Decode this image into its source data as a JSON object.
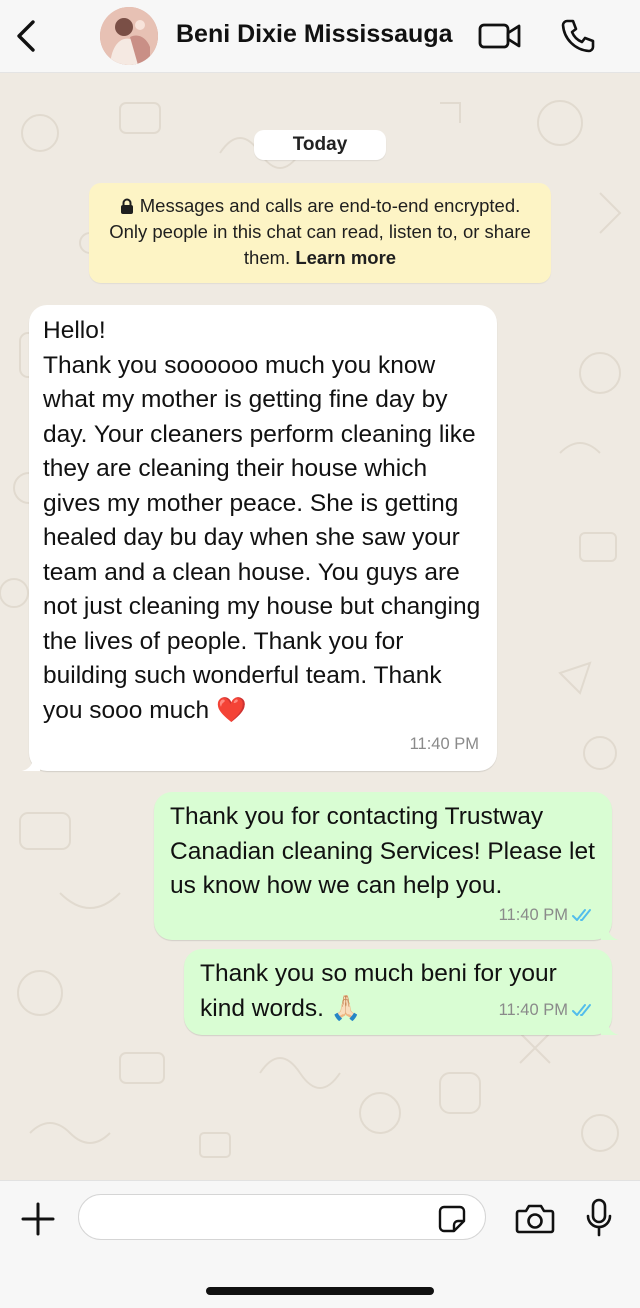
{
  "header": {
    "contact_name": "Beni Dixie Mississauga",
    "icons": {
      "back": "chevron-left-icon",
      "video": "video-camera-icon",
      "call": "phone-icon"
    }
  },
  "chat": {
    "date_chip": "Today",
    "encryption_notice": {
      "text": "Messages and calls are end-to-end encrypted. Only people in this chat can read, listen to, or share them.",
      "link_label": "Learn more",
      "icon": "lock-icon"
    },
    "messages": [
      {
        "direction": "incoming",
        "text": "Hello!\nThank you soooooo much you know what my mother is getting fine day by day. Your cleaners perform cleaning like they are cleaning their house which gives my mother peace. She is getting healed day bu day when she saw your team and a clean house. You guys are not just cleaning my house but changing the lives of people. Thank you for building such wonderful team. Thank you sooo much ❤️",
        "time": "11:40 PM"
      },
      {
        "direction": "outgoing",
        "text": "Thank you for contacting Trustway Canadian cleaning Services! Please let us know how we can help you.",
        "time": "11:40 PM",
        "status": "read"
      },
      {
        "direction": "outgoing",
        "text": "Thank you so much beni for your kind words. 🙏🏻",
        "time": "11:40 PM",
        "status": "read"
      }
    ]
  },
  "input_bar": {
    "placeholder": "",
    "value": "",
    "icons": {
      "attach": "plus-icon",
      "sticker": "sticker-icon",
      "camera": "camera-icon",
      "mic": "microphone-icon"
    }
  },
  "colors": {
    "chat_background": "#efeae2",
    "incoming_bubble": "#ffffff",
    "outgoing_bubble": "#d9fdd3",
    "notice_background": "#fdf4c5",
    "read_ticks": "#53bdeb"
  }
}
